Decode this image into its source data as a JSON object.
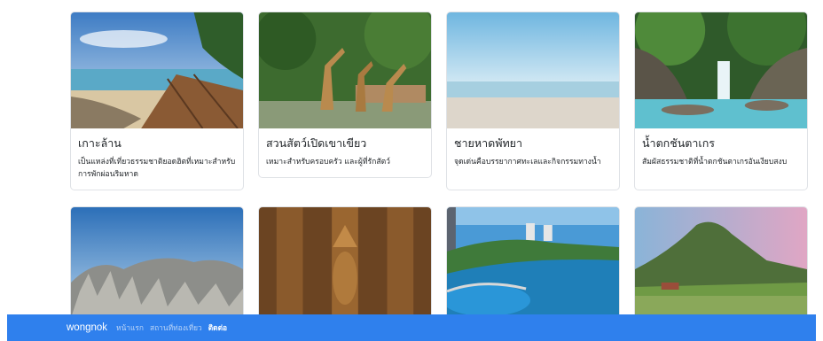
{
  "cards": [
    {
      "title": "เกาะล้าน",
      "desc": "เป็นแหล่งที่เที่ยวธรรมชาติยอดฮิตที่เหมาะสำหรับการพักผ่อนริมหาด"
    },
    {
      "title": "สวนสัตว์เปิดเขาเขียว",
      "desc": "เหมาะสำหรับครอบครัว และผู้ที่รักสัตว์"
    },
    {
      "title": "ชายหาดพัทยา",
      "desc": "จุดเด่นคือบรรยากาศทะเลและกิจกรรมทางน้ำ"
    },
    {
      "title": "น้ำตกชันตาเกร",
      "desc": "สัมผัสธรรมชาติที่น้ำตกชันตาเกรอันเงียบสงบ"
    }
  ],
  "navbar": {
    "brand": "wongnok",
    "links": [
      "หน้าแรก",
      "สถานที่ท่องเที่ยว",
      "ติดต่อ"
    ]
  },
  "colors": {
    "navbar": "#2f80ed"
  }
}
